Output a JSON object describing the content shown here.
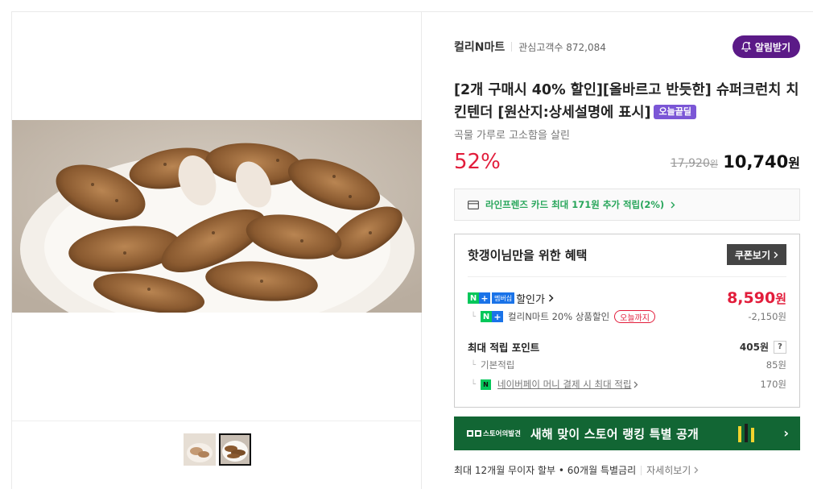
{
  "store": {
    "name": "컬리N마트",
    "fans_label": "관심고객수",
    "fans_count": "872,084",
    "alarm_button": "알림받기"
  },
  "product": {
    "title": "[2개 구매시 40% 할인][올바르고 반듯한] 슈퍼크런치 치킨텐더 [원산지:상세설명에 표시]",
    "badge": "오늘끝딜",
    "subtitle": "곡물 가루로 고소함을 살린",
    "discount_rate": "52%",
    "original_price": "17,920",
    "original_price_unit": "원",
    "sale_price": "10,740",
    "sale_price_unit": "원"
  },
  "card_promo": {
    "text": "라인프렌즈 카드 최대 171원 추가 적립(2%)"
  },
  "benefit": {
    "title": "핫갱이님만을 위한 혜택",
    "coupon_button": "쿠폰보기",
    "member_label": "멤버십",
    "member_price_label": "할인가",
    "member_price": "8,590",
    "member_price_unit": "원",
    "store_discount_label": "컬리N마트 20% 상품할인",
    "store_discount_pill": "오늘까지",
    "store_discount_value": "-2,150원",
    "points_label": "최대 적립 포인트",
    "points_value": "405원",
    "help": "?",
    "basic_points_label": "기본적립",
    "basic_points_value": "85원",
    "npay_points_label": "네이버페이 머니 결제 시 최대 적립",
    "npay_points_value": "170원"
  },
  "banner": {
    "logo": "스토어의발견",
    "text": "새해 맞이 스토어 랭킹 특별 공개"
  },
  "installment": {
    "text": "최대 12개월 무이자 할부 • 60개월 특별금리",
    "detail": "자세히보기"
  },
  "icons": {
    "alarm": "bell-plus-icon",
    "card": "credit-card-icon",
    "chevron": "chevron-right-icon"
  },
  "colors": {
    "brand_purple": "#5b1a87",
    "price_red": "#e21d3b",
    "naver_green": "#03c75a",
    "banner_green": "#126634"
  }
}
